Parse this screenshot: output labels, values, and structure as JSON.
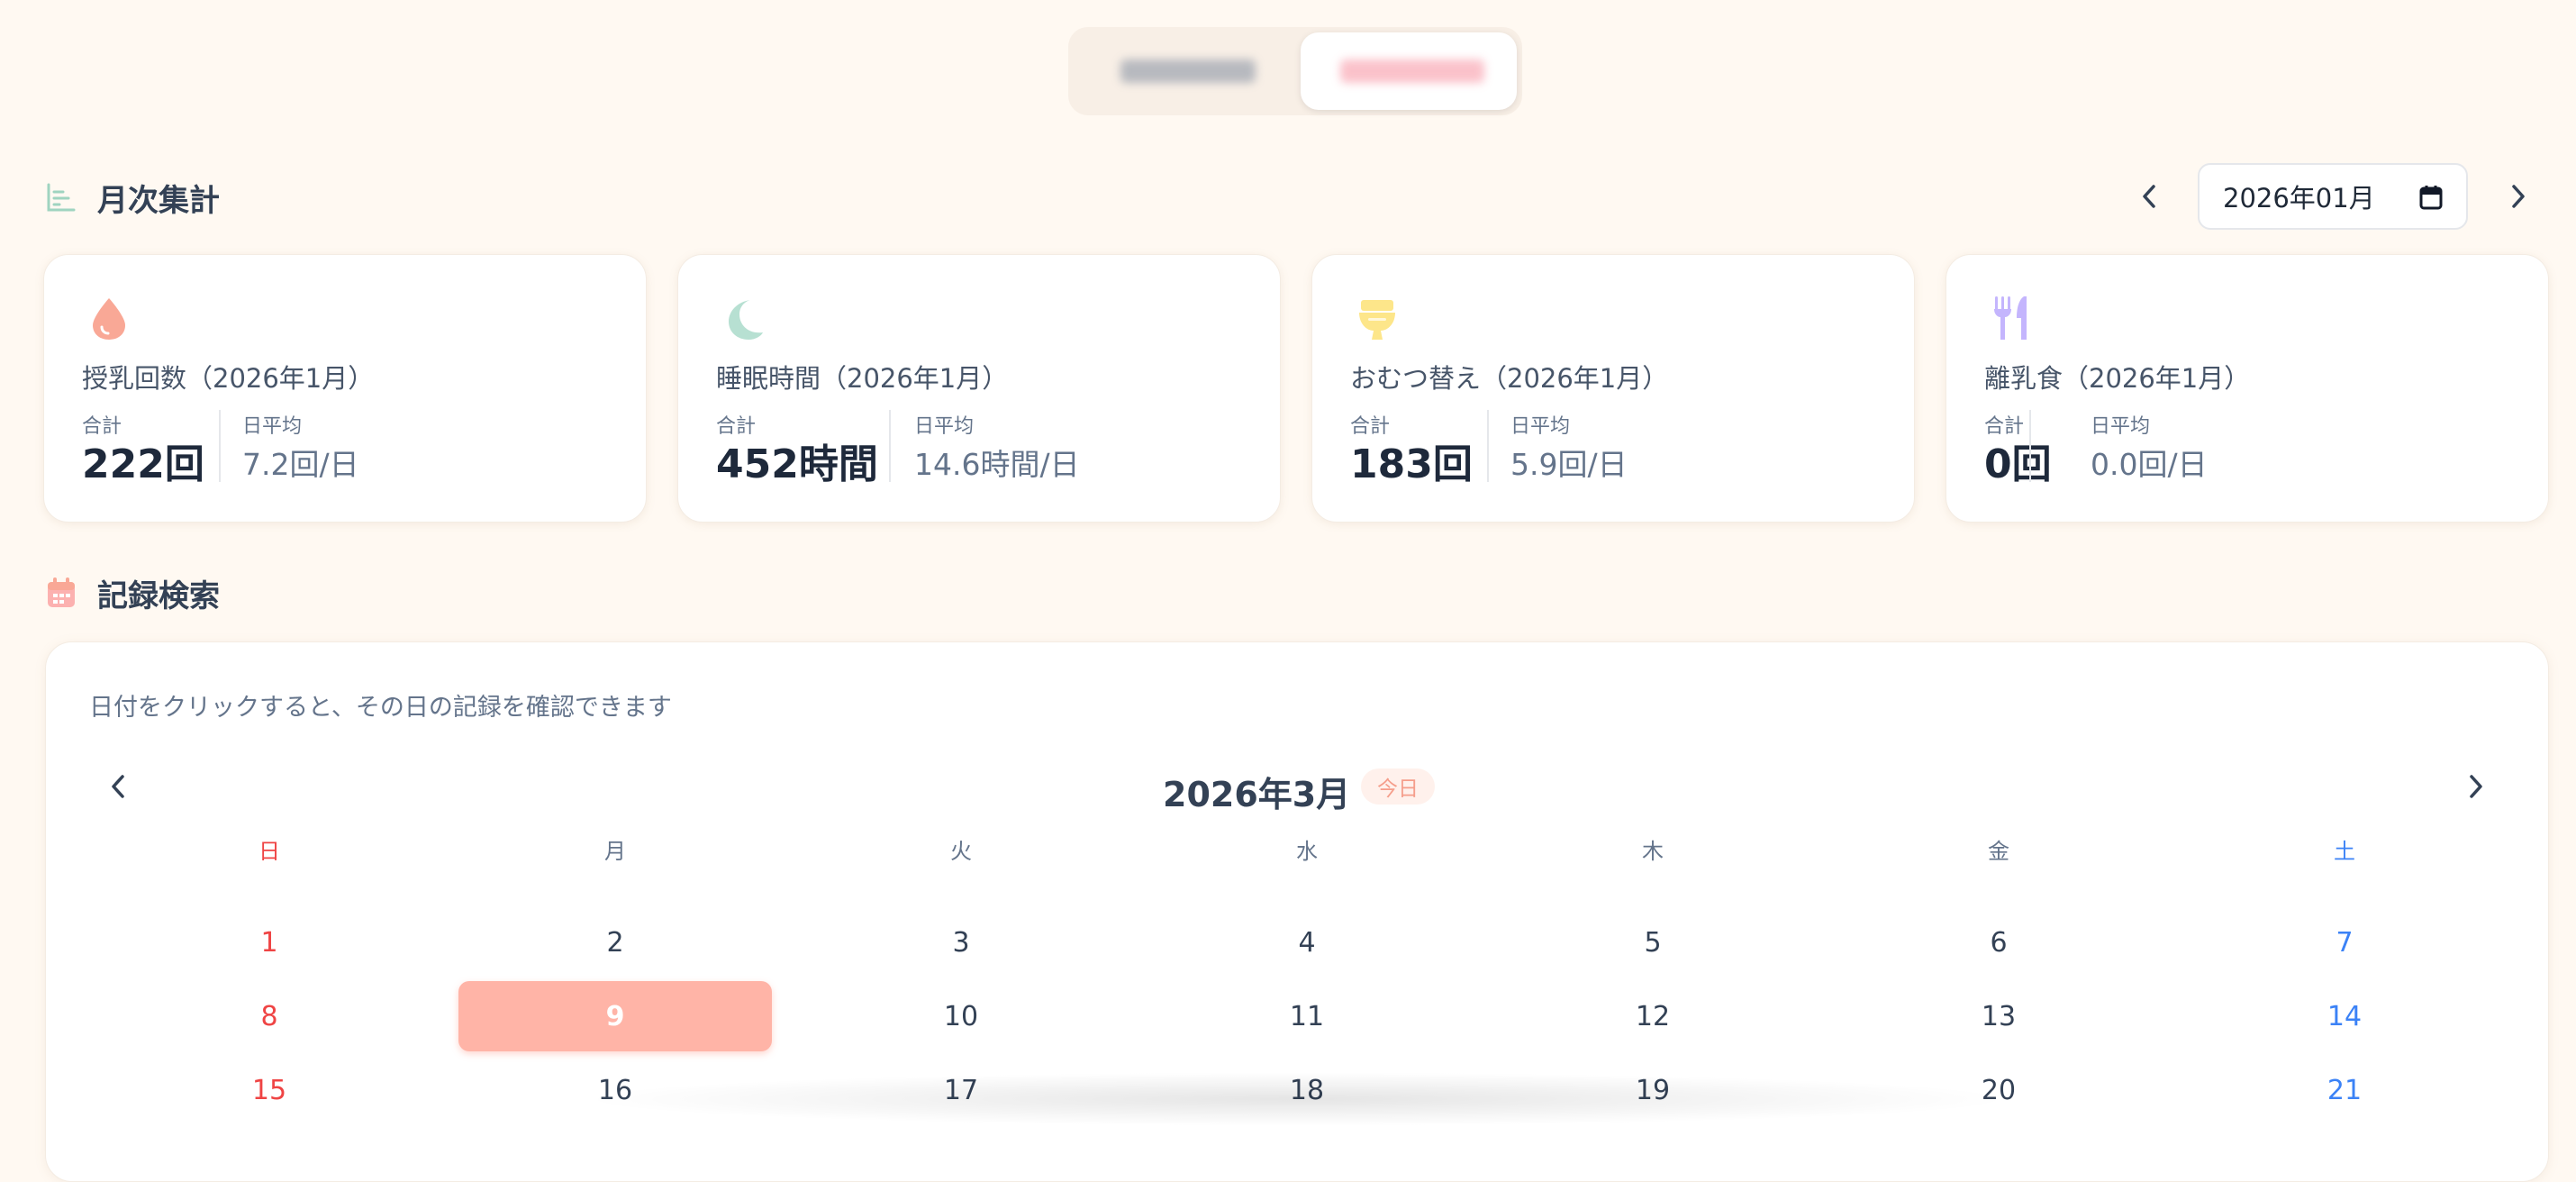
{
  "colors": {
    "background": "#fff9f2",
    "accent": "#ffb4a7",
    "sunday": "#ef4444",
    "saturday": "#3b82f6",
    "feeding_icon": "#f9a896",
    "sleep_icon": "#b7e0d2",
    "diaper_icon": "#fde68a",
    "food_icon": "#c4b5fd"
  },
  "monthly": {
    "title": "月次集計",
    "title_icon": "bar-chart-icon",
    "month_value": "2026年01月",
    "cards": [
      {
        "icon": "drop-icon",
        "title": "授乳回数（2026年1月）",
        "total_label": "合計",
        "total": "222回",
        "avg_label": "日平均",
        "avg": "7.2回/日"
      },
      {
        "icon": "moon-icon",
        "title": "睡眠時間（2026年1月）",
        "total_label": "合計",
        "total": "452時間",
        "avg_label": "日平均",
        "avg": "14.6時間/日"
      },
      {
        "icon": "toilet-icon",
        "title": "おむつ替え（2026年1月）",
        "total_label": "合計",
        "total": "183回",
        "avg_label": "日平均",
        "avg": "5.9回/日"
      },
      {
        "icon": "utensils-icon",
        "title": "離乳食（2026年1月）",
        "total_label": "合計",
        "total": "0回",
        "avg_label": "日平均",
        "avg": "0.0回/日"
      }
    ]
  },
  "search": {
    "title": "記録検索",
    "title_icon": "calendar-icon",
    "hint": "日付をクリックすると、その日の記録を確認できます",
    "calendar": {
      "month_label": "2026年3月",
      "today_label": "今日",
      "weekdays": [
        "日",
        "月",
        "火",
        "水",
        "木",
        "金",
        "土"
      ],
      "weeks": [
        [
          "1",
          "2",
          "3",
          "4",
          "5",
          "6",
          "7"
        ],
        [
          "8",
          "9",
          "10",
          "11",
          "12",
          "13",
          "14"
        ],
        [
          "15",
          "16",
          "17",
          "18",
          "19",
          "20",
          "21"
        ]
      ],
      "selected_day": "9"
    }
  }
}
